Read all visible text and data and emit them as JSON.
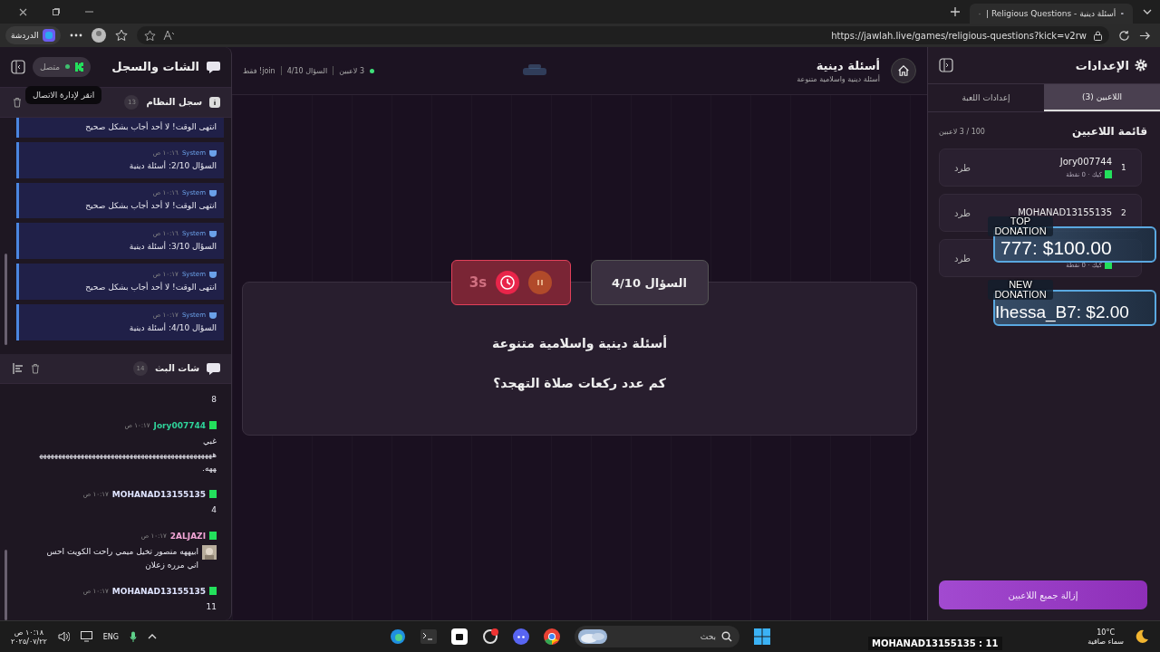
{
  "browser": {
    "tab_title": "أسئلة دينية - Religious Questions |",
    "url": "https://jawlah.live/games/religious-questions?kick=v2rw",
    "copilot_label": "الدردشة"
  },
  "chat_panel": {
    "title": "الشات والسجل",
    "connection": {
      "label": "متصل",
      "connected": true
    },
    "tooltip": "انقر لإدارة الاتصال",
    "system_log": {
      "title": "سجل النظام",
      "count": "13",
      "entries": [
        {
          "message": "انتهى الوقت! لا أحد أجاب بشكل صحيح"
        },
        {
          "sender": "System",
          "time": "١٠:١٦ ص",
          "message": "السؤال 2/10: أسئلة دينية"
        },
        {
          "sender": "System",
          "time": "١٠:١٦ ص",
          "message": "انتهى الوقت! لا أحد أجاب بشكل صحيح"
        },
        {
          "sender": "System",
          "time": "١٠:١٦ ص",
          "message": "السؤال 3/10: أسئلة دينية"
        },
        {
          "sender": "System",
          "time": "١٠:١٧ ص",
          "message": "انتهى الوقت! لا أحد أجاب بشكل صحيح"
        },
        {
          "sender": "System",
          "time": "١٠:١٧ ص",
          "message": "السؤال 4/10: أسئلة دينية"
        }
      ]
    },
    "stream_chat": {
      "title": "شات البث",
      "count": "14",
      "messages": [
        {
          "text": "8"
        },
        {
          "user": "Jory007744",
          "color": "#2fd39a",
          "time": "١٠:١٧ ص",
          "text": "غبي هههههههههههههههههههههههههههههههههههههههههههههههههه."
        },
        {
          "user": "MOHANAD13155135",
          "color": "#dfe4ff",
          "time": "١٠:١٧ ص",
          "text": "4"
        },
        {
          "user": "2ALJAZI",
          "color": "#f2a6d6",
          "time": "١٠:١٧ ص",
          "text": "ابيههه منصور تخيل ميمي راحت الكويت احس اني مرره زعلان",
          "emote": true
        },
        {
          "user": "MOHANAD13155135",
          "color": "#dfe4ff",
          "time": "١٠:١٧ ص",
          "text": "11"
        }
      ]
    }
  },
  "game": {
    "title": "أسئلة دينية",
    "subtitle": "أسئلة دينية واسلامية متنوعة",
    "status": {
      "online": true,
      "players": "3 لاعبين",
      "question": "السؤال 4/10",
      "mode": "join! فقط"
    },
    "timer": {
      "remaining": "3s",
      "running": true
    },
    "question_badge": "السؤال 4/10",
    "category": "أسئلة دينية واسلامية متنوعة",
    "question": "كم عدد ركعات صلاة التهجد؟"
  },
  "settings": {
    "title": "الإعدادات",
    "tabs": [
      {
        "label": "اللاعبين (3)",
        "selected": true
      },
      {
        "label": "إعدادات اللعبة",
        "selected": false
      }
    ],
    "list_title": "قائمة اللاعبين",
    "capacity": "100 / 3 لاعبين",
    "players": [
      {
        "rank": "1",
        "name": "Jory007744",
        "meta": "كيك · 0 نقطة",
        "action": "طرد"
      },
      {
        "rank": "2",
        "name": "MOHANAD13155135",
        "action": "طرد"
      },
      {
        "meta": "كيك · 0 نقطة",
        "action": "طرد"
      }
    ],
    "remove_all": "إزالة جميع اللاعبين"
  },
  "overlays": {
    "top_donation": {
      "label": "TOP DONATION",
      "value": "777: $100.00"
    },
    "new_donation": {
      "label": "NEW DONATION",
      "value": "Ihessa_B7: $2.00"
    },
    "ticker": "MOHANAD13155135 : 11"
  },
  "taskbar": {
    "time": "١٠:١٨ ص",
    "date": "٢٠٢٥/٠٧/٢٢",
    "language": "ENG",
    "search_placeholder": "بحث",
    "weather": {
      "temp": "10°C",
      "condition": "سماء صافية"
    }
  }
}
